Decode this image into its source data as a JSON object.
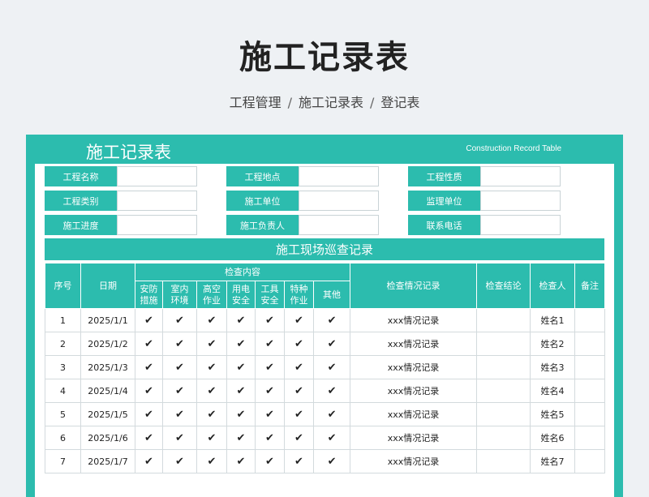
{
  "page_title": "施工记录表",
  "breadcrumb": [
    "工程管理",
    "施工记录表",
    "登记表"
  ],
  "breadcrumb_sep": "/",
  "sheet": {
    "title": "施工记录表",
    "subtitle": "Construction Record Table"
  },
  "info_fields": [
    {
      "label": "工程名称",
      "value": ""
    },
    {
      "label": "工程地点",
      "value": ""
    },
    {
      "label": "工程性质",
      "value": ""
    },
    {
      "label": "工程类别",
      "value": ""
    },
    {
      "label": "施工单位",
      "value": ""
    },
    {
      "label": "监理单位",
      "value": ""
    },
    {
      "label": "施工进度",
      "value": ""
    },
    {
      "label": "施工负责人",
      "value": ""
    },
    {
      "label": "联系电话",
      "value": ""
    }
  ],
  "section_title": "施工现场巡查记录",
  "table": {
    "headers": {
      "index": "序号",
      "date": "日期",
      "inspection_group": "检查内容",
      "inspection_items": [
        "安防\n措施",
        "室内\n环境",
        "高空\n作业",
        "用电\n安全",
        "工具\n安全",
        "特种\n作业",
        "其他"
      ],
      "record": "检查情况记录",
      "conclusion": "检查结论",
      "inspector": "检查人",
      "remark": "备注"
    },
    "check_mark": "✔",
    "rows": [
      {
        "index": "1",
        "date": "2025/1/1",
        "record": "xxx情况记录",
        "conclusion": "",
        "inspector": "姓名1",
        "remark": ""
      },
      {
        "index": "2",
        "date": "2025/1/2",
        "record": "xxx情况记录",
        "conclusion": "",
        "inspector": "姓名2",
        "remark": ""
      },
      {
        "index": "3",
        "date": "2025/1/3",
        "record": "xxx情况记录",
        "conclusion": "",
        "inspector": "姓名3",
        "remark": ""
      },
      {
        "index": "4",
        "date": "2025/1/4",
        "record": "xxx情况记录",
        "conclusion": "",
        "inspector": "姓名4",
        "remark": ""
      },
      {
        "index": "5",
        "date": "2025/1/5",
        "record": "xxx情况记录",
        "conclusion": "",
        "inspector": "姓名5",
        "remark": ""
      },
      {
        "index": "6",
        "date": "2025/1/6",
        "record": "xxx情况记录",
        "conclusion": "",
        "inspector": "姓名6",
        "remark": ""
      },
      {
        "index": "7",
        "date": "2025/1/7",
        "record": "xxx情况记录",
        "conclusion": "",
        "inspector": "姓名7",
        "remark": ""
      }
    ]
  },
  "colors": {
    "accent": "#2cbcae",
    "background": "#eef1f4"
  }
}
